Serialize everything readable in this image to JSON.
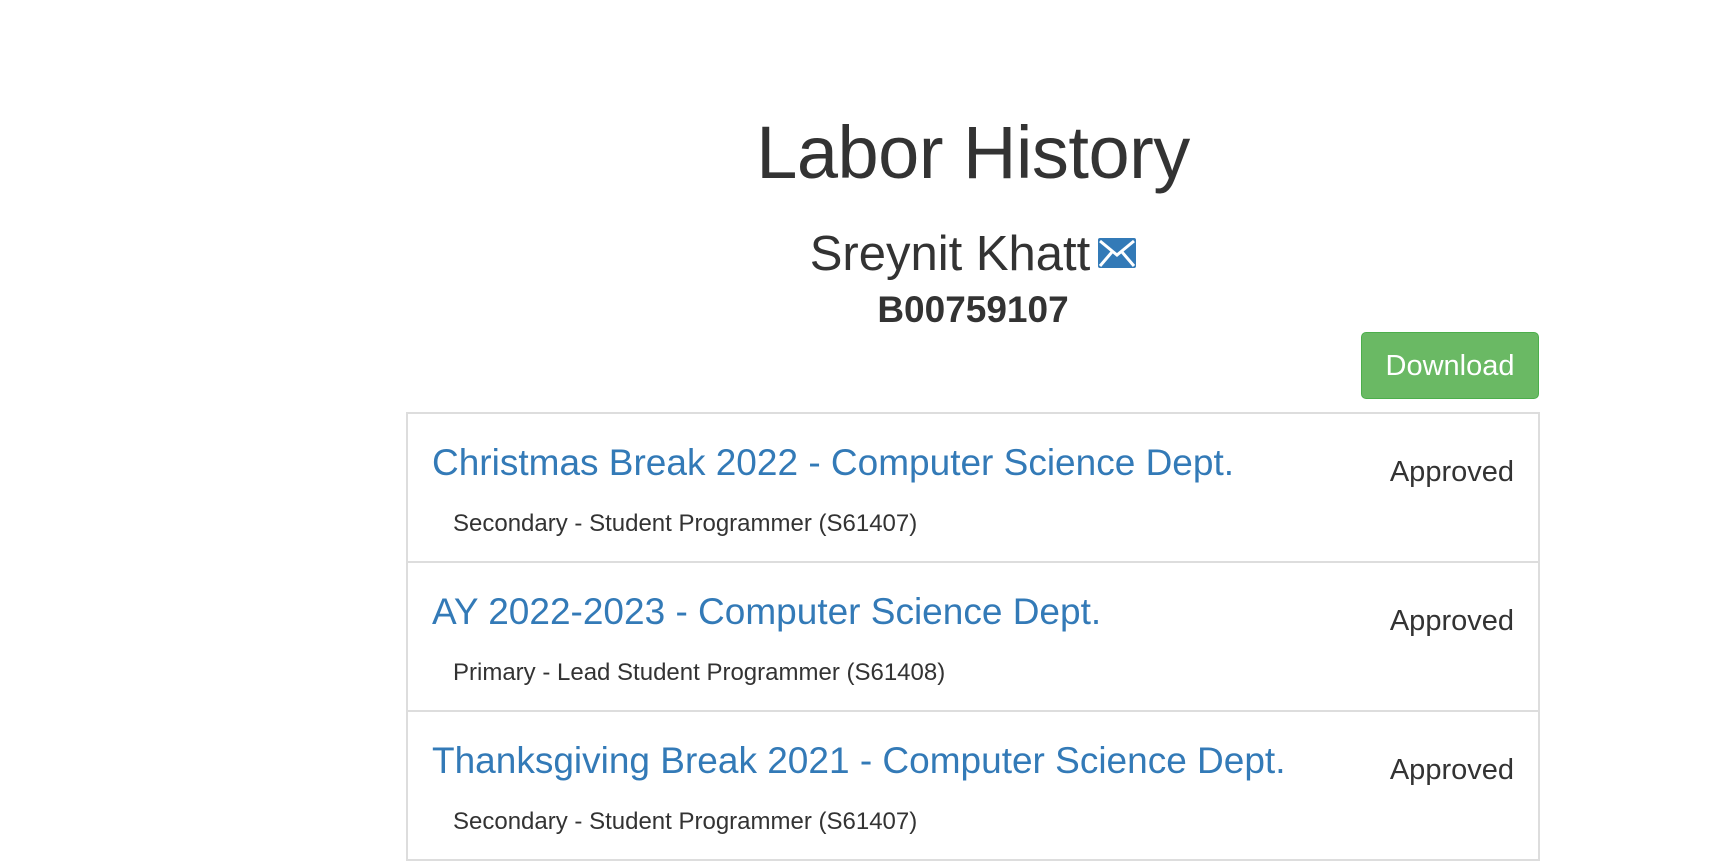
{
  "header": {
    "title": "Labor History",
    "student_name": "Sreynit Khatt",
    "mail_icon": "envelope-icon",
    "b_number": "B00759107"
  },
  "actions": {
    "download_label": "Download"
  },
  "colors": {
    "link": "#337ab7",
    "download_button": "#6ab964",
    "border": "#dddddd",
    "text": "#333333"
  },
  "history": [
    {
      "title": "Christmas Break 2022 - Computer Science Dept.",
      "position": "Secondary - Student Programmer (S61407)",
      "status": "Approved"
    },
    {
      "title": "AY 2022-2023 - Computer Science Dept.",
      "position": "Primary - Lead Student Programmer (S61408)",
      "status": "Approved"
    },
    {
      "title": "Thanksgiving Break 2021 - Computer Science Dept.",
      "position": "Secondary - Student Programmer (S61407)",
      "status": "Approved"
    }
  ]
}
